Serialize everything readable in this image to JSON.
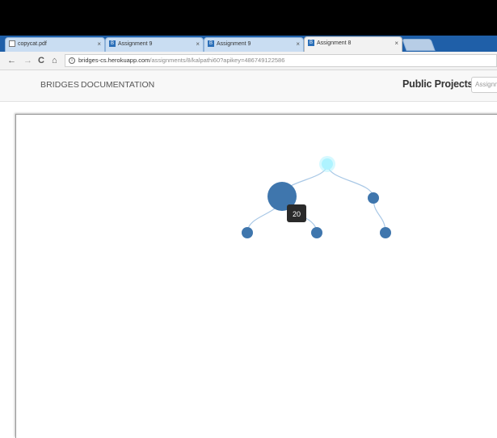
{
  "browser": {
    "tabs": [
      {
        "title": "copycat.pdf",
        "icon": "pdf-document-icon",
        "active": false
      },
      {
        "title": "Assignment 9",
        "icon": "bridges-b-icon",
        "active": false
      },
      {
        "title": "Assignment 9",
        "icon": "bridges-b-icon",
        "active": false
      },
      {
        "title": "Assignment 8",
        "icon": "bridges-b-icon",
        "active": true
      }
    ],
    "close_glyph": "×",
    "favicon_letter": "B",
    "url_host": "bridges-cs.herokuapp.com",
    "url_path": "/assignments/8/kalpathi60?apikey=486749122586",
    "nav": {
      "back": "←",
      "forward": "→",
      "reload": "C",
      "home": "⌂",
      "info": "i"
    }
  },
  "app": {
    "brand": "BRIDGES",
    "documentation": "DOCUMENTATION",
    "public_projects": "Public Projects",
    "search_placeholder": "Assignment"
  },
  "tree": {
    "tooltip": "20",
    "colors": {
      "root": "#aef3ff",
      "node": "#3f76ad",
      "link": "#a9c8e6",
      "tooltip_bg": "#2a2a2a",
      "tooltip_text": "#ffffff"
    },
    "nodes": [
      {
        "id": "root",
        "highlight": "hover"
      },
      {
        "id": "left"
      },
      {
        "id": "right"
      },
      {
        "id": "left-left"
      },
      {
        "id": "left-right"
      },
      {
        "id": "right-child"
      }
    ],
    "edges": [
      [
        "root",
        "left"
      ],
      [
        "root",
        "right"
      ],
      [
        "left",
        "left-left"
      ],
      [
        "left",
        "left-right"
      ],
      [
        "right",
        "right-child"
      ]
    ]
  }
}
